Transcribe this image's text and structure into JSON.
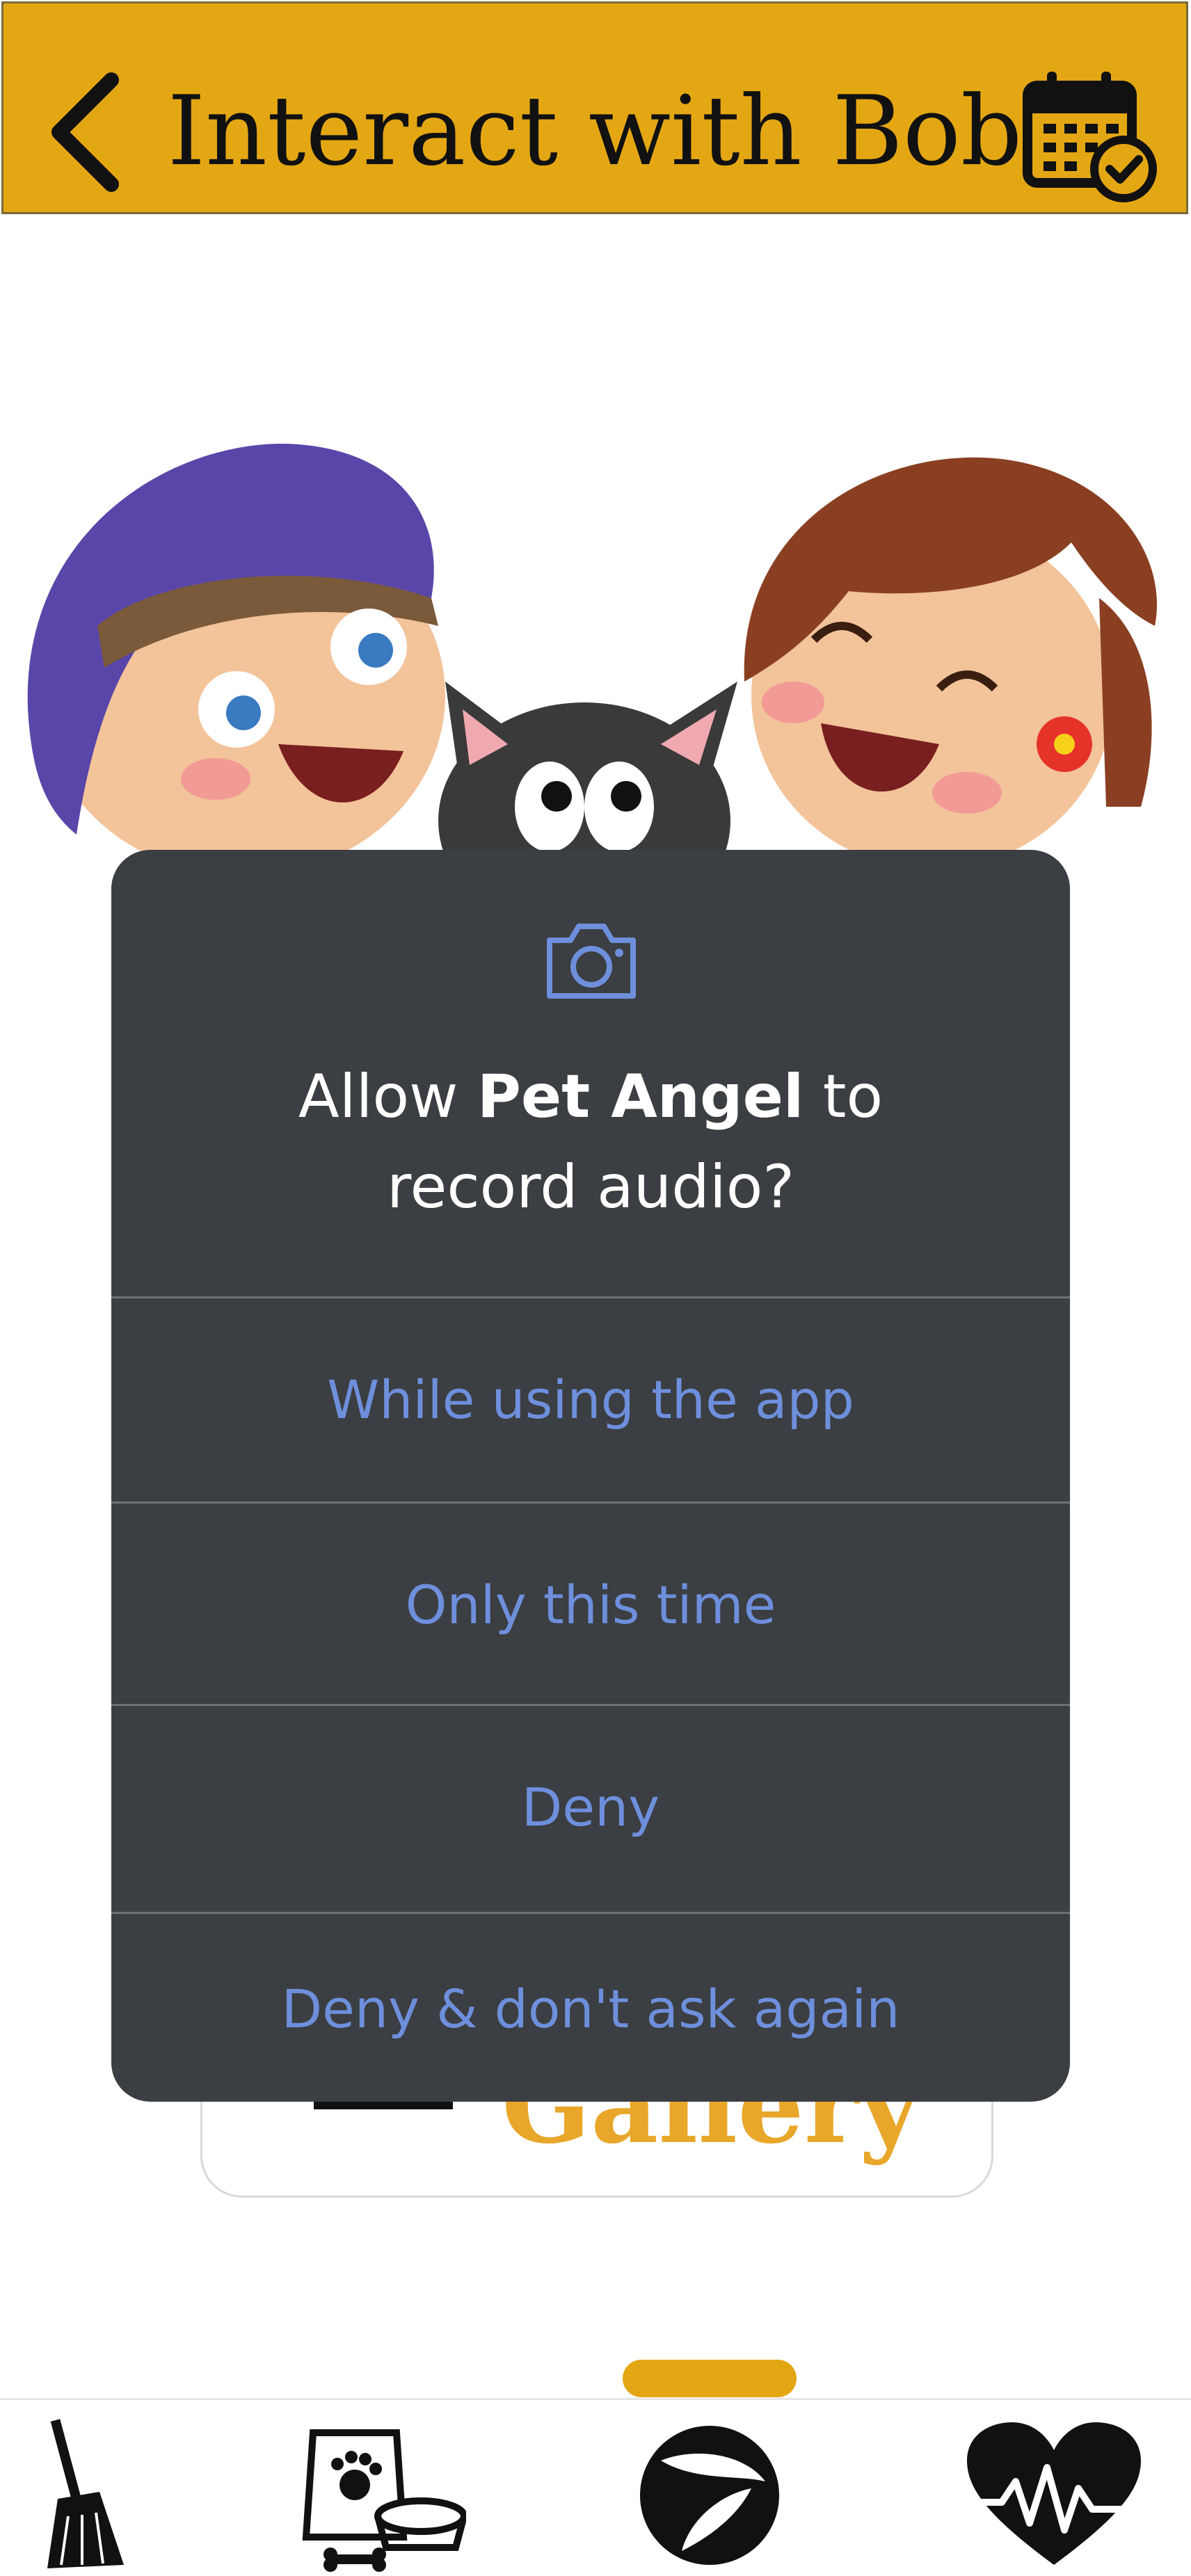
{
  "header": {
    "title": "Interact with Bob",
    "back_icon": "chevron-left-icon",
    "calendar_icon": "calendar-check-icon",
    "background": "#e4a714"
  },
  "illustration": {
    "description_icon": "kids-with-cat-illustration"
  },
  "gallery_card": {
    "label": "Gallery",
    "label_color": "#e8a72a"
  },
  "permission_dialog": {
    "icon": "camera-icon",
    "title_prefix": "Allow ",
    "title_app": "Pet Angel",
    "title_suffix": " to",
    "title_line2": "record audio?",
    "options": [
      "While using the app",
      "Only this time",
      "Deny",
      "Deny & don't ask again"
    ],
    "background": "#3b3e42",
    "option_color": "#6e8fdc"
  },
  "bottom_nav": {
    "items": [
      "broom-icon",
      "pet-food-icon",
      "ball-icon",
      "heartbeat-icon"
    ],
    "indicator_color": "#e4a714"
  }
}
